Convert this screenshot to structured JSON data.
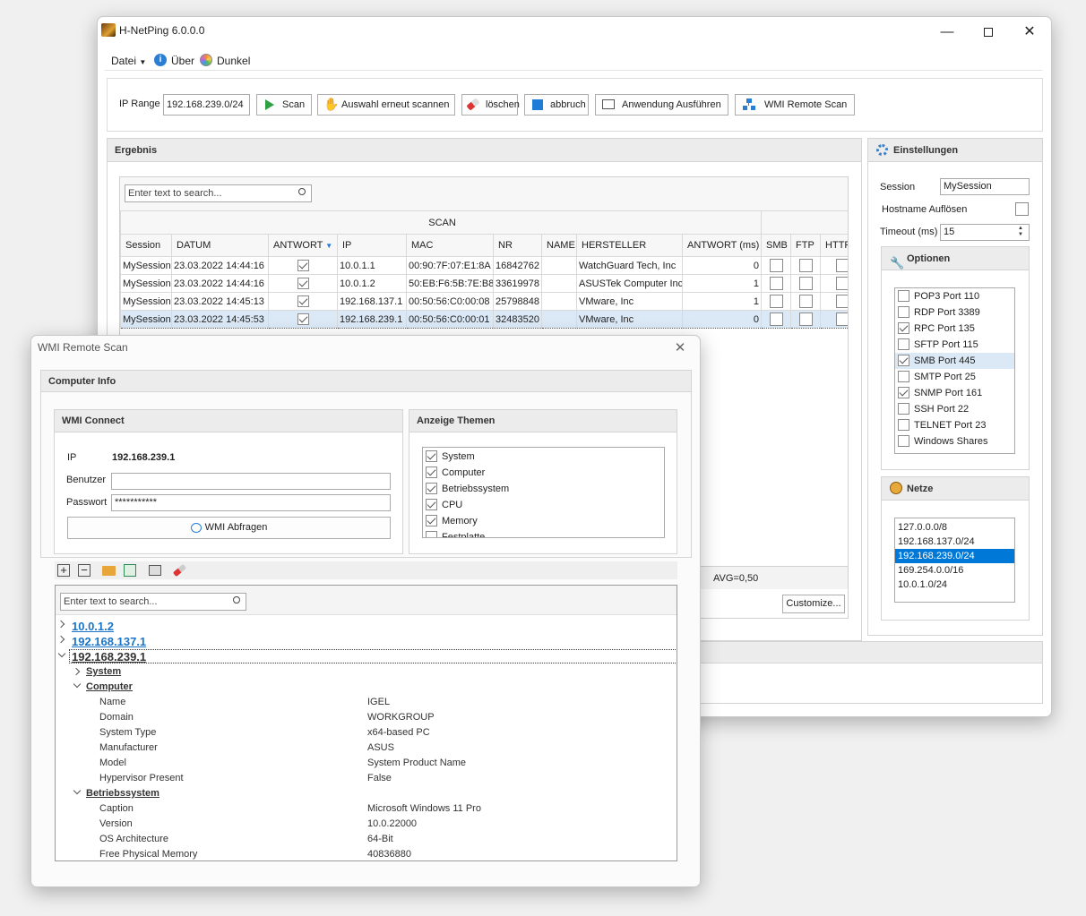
{
  "main_window": {
    "title": "H-NetPing 6.0.0.0",
    "menu": {
      "datei": "Datei",
      "ueber": "Über",
      "dunkel": "Dunkel"
    },
    "toolbar": {
      "ip_range_label": "IP Range",
      "ip_range_value": "192.168.239.0/24",
      "scan": "Scan",
      "rescan": "Auswahl erneut scannen",
      "delete": "löschen",
      "abort": "abbruch",
      "run_app": "Anwendung Ausführen",
      "wmi_remote": "WMI Remote Scan"
    },
    "result": {
      "title": "Ergebnis",
      "search_placeholder": "Enter text to search...",
      "band_header": "SCAN",
      "columns": [
        "Session",
        "DATUM",
        "ANTWORT",
        "IP",
        "MAC",
        "NR",
        "NAME",
        "HERSTELLER",
        "ANTWORT (ms)",
        "SMB",
        "FTP",
        "HTTP"
      ],
      "rows": [
        {
          "session": "MySession",
          "datum": "23.03.2022 14:44:16",
          "antwort": true,
          "ip": "10.0.1.1",
          "mac": "00:90:7F:07:E1:8A",
          "nr": "16842762",
          "name": "",
          "hersteller": "WatchGuard Tech, Inc",
          "ms": "0"
        },
        {
          "session": "MySession",
          "datum": "23.03.2022 14:44:16",
          "antwort": true,
          "ip": "10.0.1.2",
          "mac": "50:EB:F6:5B:7E:B8",
          "nr": "33619978",
          "name": "",
          "hersteller": "ASUSTek Computer Inc",
          "ms": "1"
        },
        {
          "session": "MySession",
          "datum": "23.03.2022 14:45:13",
          "antwort": true,
          "ip": "192.168.137.1",
          "mac": "00:50:56:C0:00:08",
          "nr": "25798848",
          "name": "",
          "hersteller": "VMware, Inc",
          "ms": "1"
        },
        {
          "session": "MySession",
          "datum": "23.03.2022 14:45:53",
          "antwort": true,
          "ip": "192.168.239.1",
          "mac": "00:50:56:C0:00:01",
          "nr": "32483520",
          "name": "",
          "hersteller": "VMware, Inc",
          "ms": "0"
        }
      ],
      "avg": "AVG=0,50",
      "customize": "Customize..."
    },
    "settings": {
      "title": "Einstellungen",
      "session_label": "Session",
      "session_value": "MySession",
      "hostname_label": "Hostname Auflösen",
      "timeout_label": "Timeout (ms)",
      "timeout_value": "15",
      "optionen_title": "Optionen",
      "optionen": [
        {
          "label": "POP3 Port 110",
          "checked": false
        },
        {
          "label": "RDP Port 3389",
          "checked": false
        },
        {
          "label": "RPC Port 135",
          "checked": true
        },
        {
          "label": "SFTP Port 115",
          "checked": false
        },
        {
          "label": "SMB Port 445",
          "checked": true
        },
        {
          "label": "SMTP Port 25",
          "checked": false
        },
        {
          "label": "SNMP Port 161",
          "checked": true
        },
        {
          "label": "SSH Port 22",
          "checked": false
        },
        {
          "label": "TELNET Port 23",
          "checked": false
        },
        {
          "label": "Windows Shares",
          "checked": false
        }
      ],
      "netze_title": "Netze",
      "netze": [
        "127.0.0.0/8",
        "192.168.137.0/24",
        "192.168.239.0/24",
        "169.254.0.0/16",
        "10.0.1.0/24"
      ],
      "netze_selected": "192.168.239.0/24"
    }
  },
  "wmi_window": {
    "title": "WMI Remote Scan",
    "computer_info": "Computer Info",
    "connect": {
      "title": "WMI Connect",
      "ip_label": "IP",
      "ip_value": "192.168.239.1",
      "user_label": "Benutzer",
      "user_value": "",
      "pass_label": "Passwort",
      "pass_value": "***********",
      "query_button": "WMI Abfragen"
    },
    "themes": {
      "title": "Anzeige Themen",
      "items": [
        {
          "label": "System",
          "checked": true
        },
        {
          "label": "Computer",
          "checked": true
        },
        {
          "label": "Betriebssystem",
          "checked": true
        },
        {
          "label": "CPU",
          "checked": true
        },
        {
          "label": "Memory",
          "checked": true
        },
        {
          "label": "Festplatte",
          "checked": false
        }
      ]
    },
    "tree": {
      "search_placeholder": "Enter text to search...",
      "nodes": [
        "10.0.1.2",
        "192.168.137.1",
        "192.168.239.1"
      ],
      "system": "System",
      "computer": "Computer",
      "computer_props": [
        {
          "k": "Name",
          "v": "IGEL"
        },
        {
          "k": "Domain",
          "v": "WORKGROUP"
        },
        {
          "k": "System Type",
          "v": "x64-based PC"
        },
        {
          "k": "Manufacturer",
          "v": "ASUS"
        },
        {
          "k": "Model",
          "v": "System Product Name"
        },
        {
          "k": "Hypervisor Present",
          "v": "False"
        }
      ],
      "os": "Betriebssystem",
      "os_props": [
        {
          "k": "Caption",
          "v": "Microsoft Windows 11 Pro"
        },
        {
          "k": "Version",
          "v": "10.0.22000"
        },
        {
          "k": "OS Architecture",
          "v": "64-Bit"
        },
        {
          "k": "Free Physical Memory",
          "v": "40836880"
        }
      ]
    }
  },
  "colors": {
    "accent": "#0078d7",
    "link": "#1a75c9",
    "selection": "#dbe9f7"
  }
}
